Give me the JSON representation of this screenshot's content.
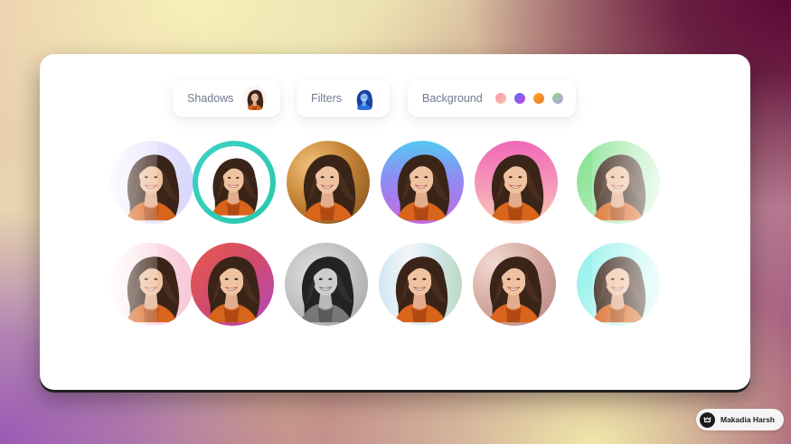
{
  "toolbar": {
    "shadows": {
      "label": "Shadows",
      "icon": "portrait-thumbnail-shadow"
    },
    "filters": {
      "label": "Filters",
      "icon": "portrait-thumbnail-blue"
    },
    "background": {
      "label": "Background",
      "swatches": [
        {
          "name": "pink-gradient-swatch",
          "colors": [
            "#ff8fb3",
            "#f7c8a0"
          ]
        },
        {
          "name": "violet-gradient-swatch",
          "colors": [
            "#5b6bff",
            "#c04ad8"
          ]
        },
        {
          "name": "orange-gradient-swatch",
          "colors": [
            "#ff9a1f",
            "#e8702a"
          ]
        },
        {
          "name": "green-gradient-swatch",
          "colors": [
            "#7be07d",
            "#c59af0"
          ]
        }
      ]
    }
  },
  "avatars": {
    "row1": [
      {
        "name": "avatar-lavender",
        "style": "lavender-faded",
        "selected": false
      },
      {
        "name": "avatar-teal-ring",
        "style": "teal-ring",
        "selected": true
      },
      {
        "name": "avatar-golden-bokeh",
        "style": "golden",
        "selected": false
      },
      {
        "name": "avatar-blue-purple",
        "style": "blue-purple",
        "selected": false
      },
      {
        "name": "avatar-pink-peach",
        "style": "pink-peach",
        "selected": false
      },
      {
        "name": "avatar-mint",
        "style": "mint-faded",
        "selected": false
      }
    ],
    "row2": [
      {
        "name": "avatar-rose",
        "style": "rose-faded",
        "selected": false
      },
      {
        "name": "avatar-red-magenta",
        "style": "red-magenta",
        "selected": false
      },
      {
        "name": "avatar-grayscale",
        "style": "grayscale",
        "selected": false
      },
      {
        "name": "avatar-window-light",
        "style": "window",
        "selected": false
      },
      {
        "name": "avatar-bokeh-warm",
        "style": "bokeh",
        "selected": false
      },
      {
        "name": "avatar-cyan",
        "style": "cyan-faded",
        "selected": false
      }
    ]
  },
  "badge": {
    "name": "Makadia Harsh",
    "icon": "author-logo-icon"
  },
  "colors": {
    "accent": "#2ad0c0",
    "pill_text": "#707a90",
    "card": "#ffffff"
  }
}
